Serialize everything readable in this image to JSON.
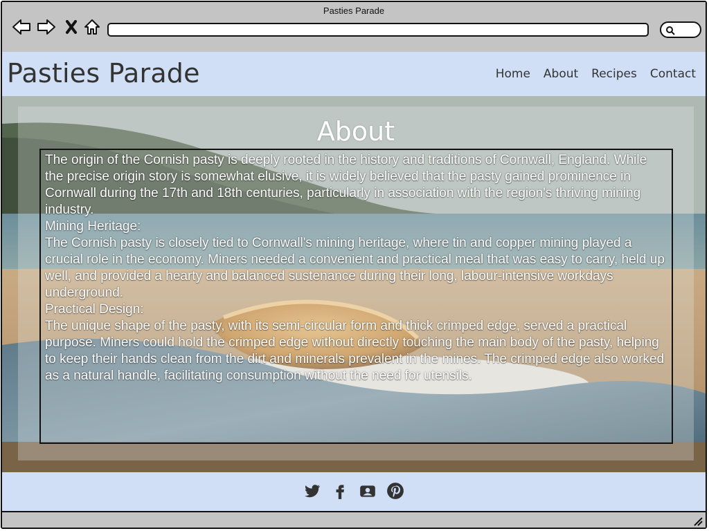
{
  "window": {
    "title": "Pasties Parade"
  },
  "toolbar": {
    "icons": [
      "back-arrow-icon",
      "forward-arrow-icon",
      "stop-icon",
      "home-icon",
      "search-icon"
    ]
  },
  "site": {
    "title": "Pasties Parade",
    "nav": [
      "Home",
      "About",
      "Recipes",
      "Contact"
    ]
  },
  "about": {
    "heading": "About",
    "paragraphs": [
      "The origin of the Cornish pasty is deeply rooted in the history and traditions of Cornwall, England. While the precise origin story is somewhat elusive, it is widely believed that the pasty gained prominence in Cornwall during the 17th and 18th centuries, particularly in association with the region's thriving mining industry.",
      "Mining Heritage:",
      "The Cornish pasty is closely tied to Cornwall's mining heritage, where tin and copper mining played a crucial role in the economy. Miners needed a convenient and practical meal that was easy to carry, held up well, and provided a hearty and balanced sustenance during their long, labour-intensive workdays underground.",
      "Practical Design:",
      "The unique shape of the pasty, with its semi-circular form and thick crimped edge, served a practical purpose. Miners could hold the crimped edge without directly touching the main body of the pasty, helping to keep their hands clean from the dirt and minerals prevalent in the mines. The crimped edge also worked as a natural handle, facilitating consumption without the need for utensils."
    ]
  },
  "footer": {
    "social_icons": [
      "twitter-icon",
      "facebook-icon",
      "meetup-icon",
      "pinterest-icon"
    ]
  },
  "colors": {
    "header_bg": "#d0dff5",
    "chrome_bg": "#c4c4c4",
    "text_dark": "#333333",
    "text_light": "#ffffff"
  }
}
